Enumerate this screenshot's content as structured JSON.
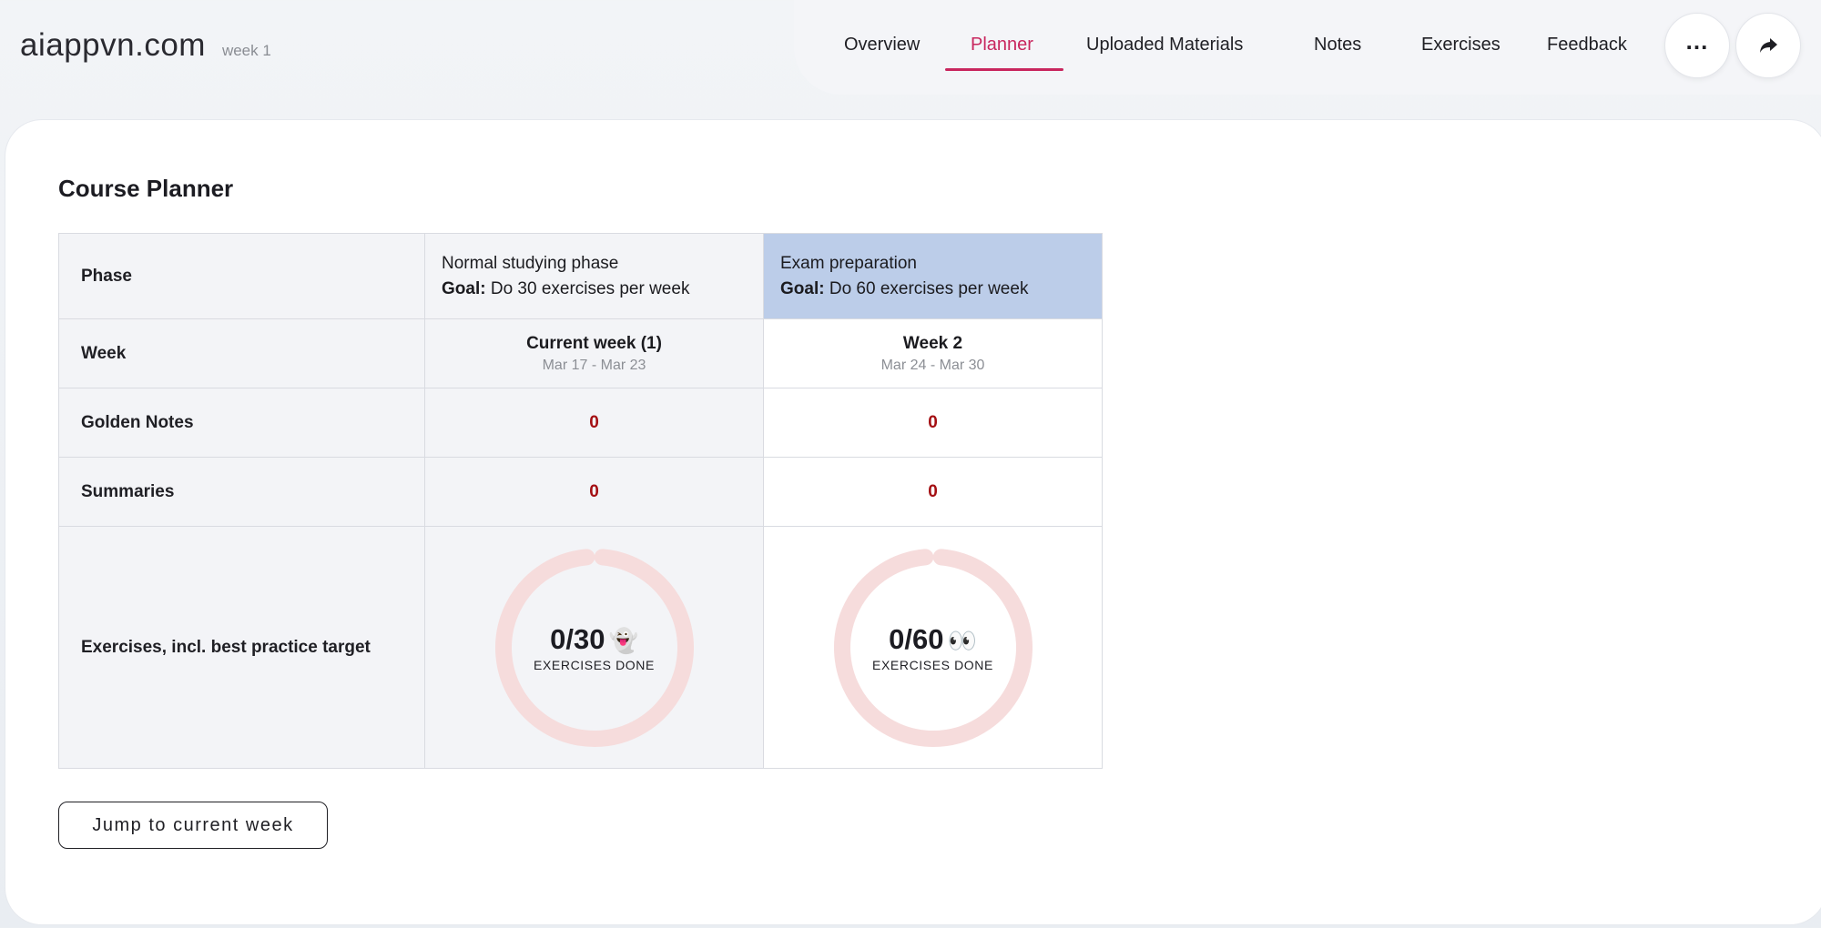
{
  "brand": {
    "name": "aiappvn.com",
    "week_tag": "week 1"
  },
  "nav": {
    "items": [
      {
        "label": "Overview",
        "active": false
      },
      {
        "label": "Planner",
        "active": true
      },
      {
        "label": "Uploaded Materials",
        "active": false
      },
      {
        "label": "Notes",
        "active": false
      },
      {
        "label": "Exercises",
        "active": false
      },
      {
        "label": "Feedback",
        "active": false
      }
    ],
    "more_icon": "more-horizontal-icon",
    "share_icon": "share-arrow-icon",
    "accent_color": "#c8265e"
  },
  "planner": {
    "title": "Course Planner",
    "row_labels": {
      "phase": "Phase",
      "week": "Week",
      "golden_notes": "Golden Notes",
      "summaries": "Summaries",
      "exercises": "Exercises, incl. best practice target"
    },
    "columns": [
      {
        "phase_name": "Normal studying phase",
        "goal_label": "Goal:",
        "goal_text": "Do 30 exercises per week",
        "week_title": "Current week (1)",
        "week_dates": "Mar 17 - Mar 23",
        "golden_notes": "0",
        "summaries": "0",
        "exercises_done": 0,
        "exercises_target": 30,
        "exercises_value": "0/30",
        "emoji": "👻",
        "exercises_caption": "EXERCISES DONE",
        "highlighted": false
      },
      {
        "phase_name": "Exam preparation",
        "goal_label": "Goal:",
        "goal_text": "Do 60 exercises per week",
        "week_title": "Week 2",
        "week_dates": "Mar 24 - Mar 30",
        "golden_notes": "0",
        "summaries": "0",
        "exercises_done": 0,
        "exercises_target": 60,
        "exercises_value": "0/60",
        "emoji": "👀",
        "exercises_caption": "EXERCISES DONE",
        "highlighted": true
      }
    ],
    "highlight_color": "#bccde9",
    "count_color": "#a40f13",
    "ring_color": "#f6dcdc",
    "jump_button": "Jump to current week"
  }
}
